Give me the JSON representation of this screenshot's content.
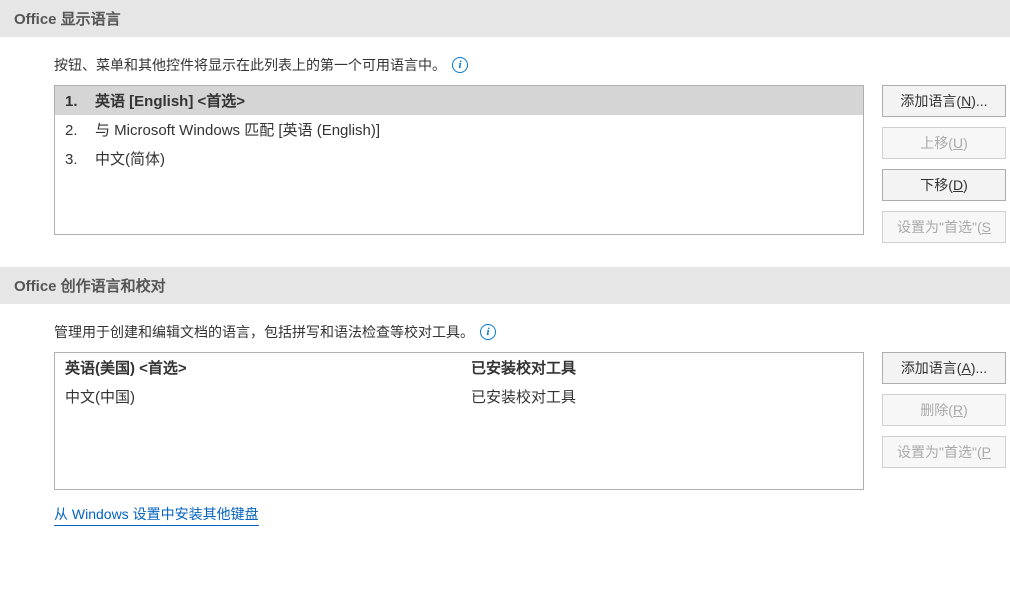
{
  "display_section": {
    "title": "Office 显示语言",
    "description": "按钮、菜单和其他控件将显示在此列表上的第一个可用语言中。",
    "items": [
      {
        "num": "1.",
        "label": "英语 [English] <首选>",
        "selected": true
      },
      {
        "num": "2.",
        "label": "与 Microsoft Windows 匹配 [英语 (English)]",
        "selected": false
      },
      {
        "num": "3.",
        "label": "中文(简体)",
        "selected": false
      }
    ],
    "buttons": {
      "add": {
        "label": "添加语言(",
        "accel": "N",
        "suffix": ")...",
        "disabled": false
      },
      "up": {
        "label": "上移(",
        "accel": "U",
        "suffix": ")",
        "disabled": true
      },
      "down": {
        "label": "下移(",
        "accel": "D",
        "suffix": ")",
        "disabled": false
      },
      "preferred": {
        "label": "设置为\"首选\"(",
        "accel": "S",
        "suffix": "",
        "disabled": true
      }
    }
  },
  "author_section": {
    "title": "Office 创作语言和校对",
    "description": "管理用于创建和编辑文档的语言，包括拼写和语法检查等校对工具。",
    "items": [
      {
        "lang": "英语(美国) <首选>",
        "status": "已安装校对工具",
        "selected": true
      },
      {
        "lang": "中文(中国)",
        "status": "已安装校对工具",
        "selected": false
      }
    ],
    "buttons": {
      "add": {
        "label": "添加语言(",
        "accel": "A",
        "suffix": ")...",
        "disabled": false
      },
      "remove": {
        "label": "删除(",
        "accel": "R",
        "suffix": ")",
        "disabled": true
      },
      "preferred": {
        "label": "设置为\"首选\"(",
        "accel": "P",
        "suffix": "",
        "disabled": true
      }
    },
    "link": "从 Windows 设置中安装其他键盘"
  }
}
